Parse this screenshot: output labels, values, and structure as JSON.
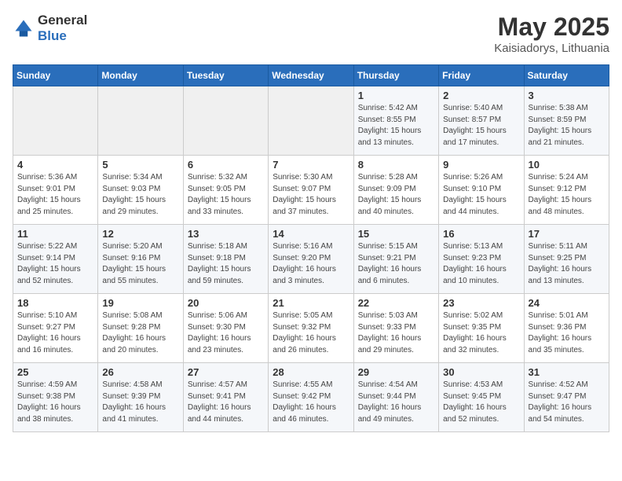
{
  "header": {
    "logo_general": "General",
    "logo_blue": "Blue",
    "month": "May 2025",
    "location": "Kaisiadorys, Lithuania"
  },
  "weekdays": [
    "Sunday",
    "Monday",
    "Tuesday",
    "Wednesday",
    "Thursday",
    "Friday",
    "Saturday"
  ],
  "weeks": [
    [
      {
        "day": "",
        "sunrise": "",
        "sunset": "",
        "daylight": ""
      },
      {
        "day": "",
        "sunrise": "",
        "sunset": "",
        "daylight": ""
      },
      {
        "day": "",
        "sunrise": "",
        "sunset": "",
        "daylight": ""
      },
      {
        "day": "",
        "sunrise": "",
        "sunset": "",
        "daylight": ""
      },
      {
        "day": "1",
        "sunrise": "5:42 AM",
        "sunset": "8:55 PM",
        "daylight": "15 hours and 13 minutes."
      },
      {
        "day": "2",
        "sunrise": "5:40 AM",
        "sunset": "8:57 PM",
        "daylight": "15 hours and 17 minutes."
      },
      {
        "day": "3",
        "sunrise": "5:38 AM",
        "sunset": "8:59 PM",
        "daylight": "15 hours and 21 minutes."
      }
    ],
    [
      {
        "day": "4",
        "sunrise": "5:36 AM",
        "sunset": "9:01 PM",
        "daylight": "15 hours and 25 minutes."
      },
      {
        "day": "5",
        "sunrise": "5:34 AM",
        "sunset": "9:03 PM",
        "daylight": "15 hours and 29 minutes."
      },
      {
        "day": "6",
        "sunrise": "5:32 AM",
        "sunset": "9:05 PM",
        "daylight": "15 hours and 33 minutes."
      },
      {
        "day": "7",
        "sunrise": "5:30 AM",
        "sunset": "9:07 PM",
        "daylight": "15 hours and 37 minutes."
      },
      {
        "day": "8",
        "sunrise": "5:28 AM",
        "sunset": "9:09 PM",
        "daylight": "15 hours and 40 minutes."
      },
      {
        "day": "9",
        "sunrise": "5:26 AM",
        "sunset": "9:10 PM",
        "daylight": "15 hours and 44 minutes."
      },
      {
        "day": "10",
        "sunrise": "5:24 AM",
        "sunset": "9:12 PM",
        "daylight": "15 hours and 48 minutes."
      }
    ],
    [
      {
        "day": "11",
        "sunrise": "5:22 AM",
        "sunset": "9:14 PM",
        "daylight": "15 hours and 52 minutes."
      },
      {
        "day": "12",
        "sunrise": "5:20 AM",
        "sunset": "9:16 PM",
        "daylight": "15 hours and 55 minutes."
      },
      {
        "day": "13",
        "sunrise": "5:18 AM",
        "sunset": "9:18 PM",
        "daylight": "15 hours and 59 minutes."
      },
      {
        "day": "14",
        "sunrise": "5:16 AM",
        "sunset": "9:20 PM",
        "daylight": "16 hours and 3 minutes."
      },
      {
        "day": "15",
        "sunrise": "5:15 AM",
        "sunset": "9:21 PM",
        "daylight": "16 hours and 6 minutes."
      },
      {
        "day": "16",
        "sunrise": "5:13 AM",
        "sunset": "9:23 PM",
        "daylight": "16 hours and 10 minutes."
      },
      {
        "day": "17",
        "sunrise": "5:11 AM",
        "sunset": "9:25 PM",
        "daylight": "16 hours and 13 minutes."
      }
    ],
    [
      {
        "day": "18",
        "sunrise": "5:10 AM",
        "sunset": "9:27 PM",
        "daylight": "16 hours and 16 minutes."
      },
      {
        "day": "19",
        "sunrise": "5:08 AM",
        "sunset": "9:28 PM",
        "daylight": "16 hours and 20 minutes."
      },
      {
        "day": "20",
        "sunrise": "5:06 AM",
        "sunset": "9:30 PM",
        "daylight": "16 hours and 23 minutes."
      },
      {
        "day": "21",
        "sunrise": "5:05 AM",
        "sunset": "9:32 PM",
        "daylight": "16 hours and 26 minutes."
      },
      {
        "day": "22",
        "sunrise": "5:03 AM",
        "sunset": "9:33 PM",
        "daylight": "16 hours and 29 minutes."
      },
      {
        "day": "23",
        "sunrise": "5:02 AM",
        "sunset": "9:35 PM",
        "daylight": "16 hours and 32 minutes."
      },
      {
        "day": "24",
        "sunrise": "5:01 AM",
        "sunset": "9:36 PM",
        "daylight": "16 hours and 35 minutes."
      }
    ],
    [
      {
        "day": "25",
        "sunrise": "4:59 AM",
        "sunset": "9:38 PM",
        "daylight": "16 hours and 38 minutes."
      },
      {
        "day": "26",
        "sunrise": "4:58 AM",
        "sunset": "9:39 PM",
        "daylight": "16 hours and 41 minutes."
      },
      {
        "day": "27",
        "sunrise": "4:57 AM",
        "sunset": "9:41 PM",
        "daylight": "16 hours and 44 minutes."
      },
      {
        "day": "28",
        "sunrise": "4:55 AM",
        "sunset": "9:42 PM",
        "daylight": "16 hours and 46 minutes."
      },
      {
        "day": "29",
        "sunrise": "4:54 AM",
        "sunset": "9:44 PM",
        "daylight": "16 hours and 49 minutes."
      },
      {
        "day": "30",
        "sunrise": "4:53 AM",
        "sunset": "9:45 PM",
        "daylight": "16 hours and 52 minutes."
      },
      {
        "day": "31",
        "sunrise": "4:52 AM",
        "sunset": "9:47 PM",
        "daylight": "16 hours and 54 minutes."
      }
    ]
  ],
  "labels": {
    "sunrise": "Sunrise:",
    "sunset": "Sunset:",
    "daylight": "Daylight hours"
  }
}
